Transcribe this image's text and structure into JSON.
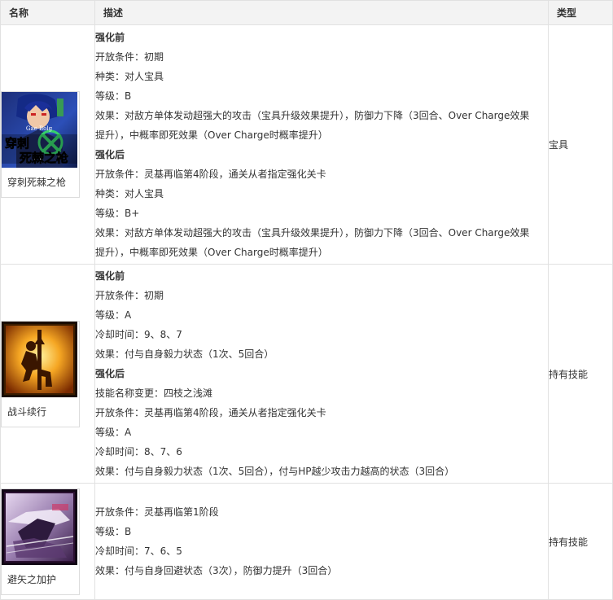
{
  "table": {
    "headers": {
      "name": "名称",
      "desc": "描述",
      "type": "类型"
    },
    "rows": [
      {
        "name": "穿刺死棘之枪",
        "icon_text_top": "Gae Bolg",
        "icon_text_1": "穿刺",
        "icon_text_2": "死棘之枪",
        "type": "宝具",
        "lines": [
          {
            "text": "强化前",
            "head": true
          },
          {
            "text": "开放条件：初期"
          },
          {
            "text": "种类：对人宝具"
          },
          {
            "text": "等级：B"
          },
          {
            "text": "效果：对敌方单体发动超强大的攻击（宝具升级效果提升），防御力下降（3回合、Over Charge效果"
          },
          {
            "text": "提升），中概率即死效果（Over Charge时概率提升）"
          },
          {
            "text": "强化后",
            "head": true
          },
          {
            "text": "开放条件：灵基再临第4阶段，通关从者指定强化关卡"
          },
          {
            "text": "种类：对人宝具"
          },
          {
            "text": "等级：B+"
          },
          {
            "text": "效果：对敌方单体发动超强大的攻击（宝具升级效果提升），防御力下降（3回合、Over Charge效果"
          },
          {
            "text": "提升），中概率即死效果（Over Charge时概率提升）"
          }
        ]
      },
      {
        "name": "战斗续行",
        "type": "持有技能",
        "lines": [
          {
            "text": "强化前",
            "head": true
          },
          {
            "text": "开放条件：初期"
          },
          {
            "text": "等级：A"
          },
          {
            "text": "冷却时间：9、8、7"
          },
          {
            "text": "效果：付与自身毅力状态（1次、5回合）"
          },
          {
            "text": "强化后",
            "head": true
          },
          {
            "text": "技能名称变更：四枝之浅滩"
          },
          {
            "text": "开放条件：灵基再临第4阶段，通关从者指定强化关卡"
          },
          {
            "text": "等级：A"
          },
          {
            "text": "冷却时间：8、7、6"
          },
          {
            "text": "效果：付与自身毅力状态（1次、5回合），付与HP越少攻击力越高的状态（3回合）"
          }
        ]
      },
      {
        "name": "避矢之加护",
        "type": "持有技能",
        "lines": [
          {
            "text": "开放条件：灵基再临第1阶段"
          },
          {
            "text": "等级：B"
          },
          {
            "text": "冷却时间：7、6、5"
          },
          {
            "text": "效果：付与自身回避状态（3次），防御力提升（3回合）"
          }
        ]
      }
    ]
  }
}
